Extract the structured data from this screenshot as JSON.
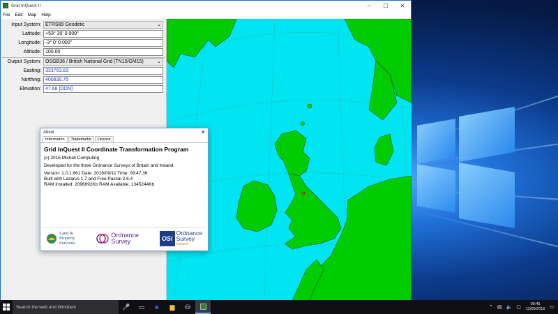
{
  "window": {
    "title": "Grid InQuest II",
    "minimize": "–",
    "maximize": "☐",
    "close": "✕"
  },
  "menu": [
    "File",
    "Edit",
    "Map",
    "Help"
  ],
  "input": {
    "system_label": "Input System:",
    "system_value": "ETRS89 Geodetic",
    "latitude_label": "Latitude:",
    "latitude_value": "+53° 30' 0.000\"",
    "longitude_label": "Longitude:",
    "longitude_value": "-3° 0' 0.000\"",
    "altitude_label": "Altitude:",
    "altitude_value": "100.00"
  },
  "output": {
    "system_label": "Output System:",
    "system_value": "OSGB36 / British National Grid (TN15/GM15)",
    "easting_label": "Easting:",
    "easting_value": "333763.83",
    "northing_label": "Northing:",
    "northing_value": "400830.75",
    "elevation_label": "Elevation:",
    "elevation_value": "47.68 [ODN]"
  },
  "about": {
    "title": "About",
    "close": "✕",
    "tabs": [
      "Information",
      "Trademarks",
      "Licence"
    ],
    "program_title": "Grid InQuest II Coordinate Transformation Program",
    "copyright": "(c) 2016 Michell Computing",
    "developed": "Developed for the three Ordnance Surveys of Britain and Ireland.",
    "version_line": "Version: 1.0.1.661  Date: 2016/09/11  Time: 09:47:36",
    "built_line": "Built with Lazarus 1.7 and Free Pascal 2.6.4",
    "ram_line": "RAM Installed: 2096692Kb RAM Available: 1345244Kb",
    "logo_lps_line1": "Land &",
    "logo_lps_line2": "Property",
    "logo_lps_line3": "Services.",
    "logo_os_line1": "Ordnance",
    "logo_os_line2": "Survey",
    "logo_osi_mark": "OSi",
    "logo_osi_line1": "Ordnance",
    "logo_osi_line2": "Survey",
    "logo_osi_line3": "Ireland"
  },
  "taskbar": {
    "search_placeholder": "Search the web and Windows",
    "time": "09:45",
    "date": "12/09/2016"
  },
  "colors": {
    "sea": "#00e5f2",
    "land": "#00cc00",
    "field_value_blue": "#1a3acc"
  }
}
